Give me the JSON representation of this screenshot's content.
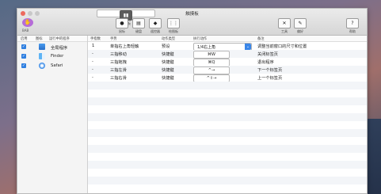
{
  "window": {
    "title": "触摸板"
  },
  "toolbar": {
    "left_label": "BAB",
    "items": [
      {
        "label": "触摸板"
      },
      {
        "label": "鼠标"
      },
      {
        "label": "键盘"
      },
      {
        "label": "遥控器"
      },
      {
        "label": "绘图板"
      }
    ],
    "right": [
      {
        "label": "工具"
      },
      {
        "label": "偏好"
      },
      {
        "label": "帮助"
      }
    ]
  },
  "sidebar": {
    "headers": {
      "enabled": "启用",
      "icon": "图标",
      "apps": "运行中的程序"
    },
    "apps": [
      {
        "name": "全局程序"
      },
      {
        "name": "Finder"
      },
      {
        "name": "Safari"
      }
    ]
  },
  "table": {
    "headers": {
      "finger": "手指数",
      "gesture": "手势",
      "action_type": "动作类型",
      "action": "执行动作",
      "note": "备注"
    },
    "rows": [
      {
        "finger": "1",
        "gesture": "单指右上角轻触",
        "type": "预设",
        "action": "1/4右上角",
        "note": "调整当前窗口的尺寸和位置"
      },
      {
        "finger": "-",
        "gesture": "三指移动",
        "type": "快捷键",
        "action": "⌘W",
        "note": "关闭标签页"
      },
      {
        "finger": "-",
        "gesture": "三指拖拽",
        "type": "快捷键",
        "action": "⌘Q",
        "note": "退出程序"
      },
      {
        "finger": "-",
        "gesture": "三指左滑",
        "type": "快捷键",
        "action": "^→",
        "note": "下一个标签页"
      },
      {
        "finger": "-",
        "gesture": "三指右滑",
        "type": "快捷键",
        "action": "^⇧→",
        "note": "上一个标签页"
      }
    ]
  }
}
